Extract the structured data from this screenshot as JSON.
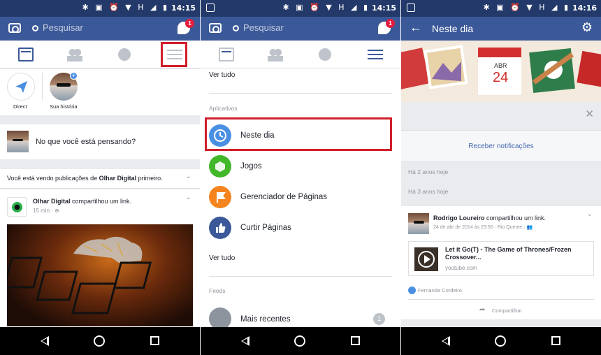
{
  "status": {
    "time1": "14:15",
    "time2": "14:15",
    "time3": "14:16",
    "icons": "✱ ▣ ⏰ ▼ H ◢ ▮"
  },
  "header": {
    "search_placeholder": "Pesquisar",
    "messenger_badge": "1",
    "title": "Neste dia"
  },
  "panel1": {
    "stories": [
      {
        "label": "Direct"
      },
      {
        "label": "Sua história"
      }
    ],
    "composer_prompt": "No que você está pensando?",
    "priority_pre": "Você está vendo publicações de ",
    "priority_name": "Olhar Digital",
    "priority_post": " primeiro.",
    "post": {
      "author": "Olhar Digital",
      "action": " compartilhou um link.",
      "time": "15 min · "
    }
  },
  "panel2": {
    "see_all_1": "Ver tudo",
    "section_apps": "Aplicativos",
    "apps": [
      {
        "label": "Neste dia",
        "color": "#4a90e2"
      },
      {
        "label": "Jogos",
        "color": "#42b72a"
      },
      {
        "label": "Gerenciador de Páginas",
        "color": "#f5841f"
      },
      {
        "label": "Curtir Páginas",
        "color": "#3b5998"
      }
    ],
    "see_all_2": "Ver tudo",
    "section_feeds": "Feeds",
    "feed_item": "Mais recentes",
    "feed_count": "1"
  },
  "panel3": {
    "calendar_month": "ABR",
    "calendar_day": "24",
    "receive_notifications": "Receber notificações",
    "years_2": "Há 2 anos hoje",
    "years_3": "Há 3 anos hoje",
    "post": {
      "author": "Rodrigo Loureiro",
      "action": " compartilhou um link.",
      "meta": "24 de abr de 2014 às 23:50 · Rio Quente · ",
      "link_title": "Let it Go(T) - The Game of Thrones/Frozen Crossover...",
      "link_domain": "youtube.com",
      "liker": "Fernanda Cordeiro",
      "share": "Compartilhar"
    }
  }
}
